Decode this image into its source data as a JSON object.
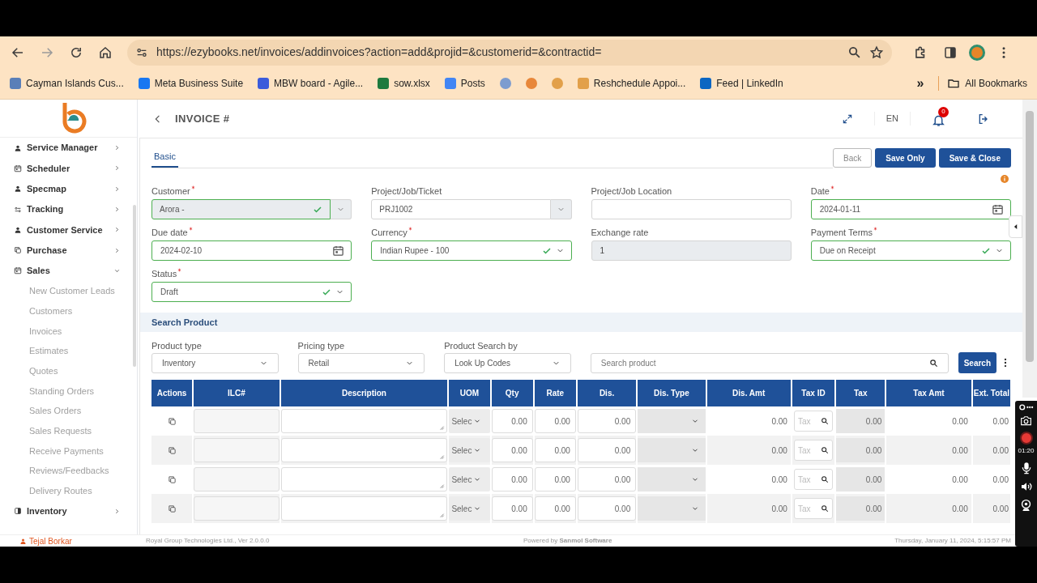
{
  "browser": {
    "url": "https://ezybooks.net/invoices/addinvoices?action=add&projid=&customerid=&contractid=",
    "bookmarks": [
      {
        "kind": "link",
        "label": "Cayman Islands Cus..."
      },
      {
        "kind": "link",
        "label": "Meta Business Suite"
      },
      {
        "kind": "link",
        "label": "MBW board - Agile..."
      },
      {
        "kind": "link",
        "label": "sow.xlsx"
      },
      {
        "kind": "link",
        "label": "Posts"
      },
      {
        "kind": "icon"
      },
      {
        "kind": "icon"
      },
      {
        "kind": "icon"
      },
      {
        "kind": "link",
        "label": "Reshchedule Appoi..."
      },
      {
        "kind": "link",
        "label": "Feed | LinkedIn"
      }
    ],
    "more": "»",
    "all_bookmarks": "All Bookmarks"
  },
  "sidebar": {
    "items": [
      {
        "label": "Service Manager",
        "expanded": false
      },
      {
        "label": "Scheduler",
        "expanded": false
      },
      {
        "label": "Specmap",
        "expanded": false
      },
      {
        "label": "Tracking",
        "expanded": false
      },
      {
        "label": "Customer Service",
        "expanded": false
      },
      {
        "label": "Purchase",
        "expanded": false
      },
      {
        "label": "Sales",
        "expanded": true,
        "children": [
          {
            "label": "New Customer Leads"
          },
          {
            "label": "Customers"
          },
          {
            "label": "Invoices"
          },
          {
            "label": "Estimates"
          },
          {
            "label": "Quotes"
          },
          {
            "label": "Standing Orders"
          },
          {
            "label": "Sales Orders"
          },
          {
            "label": "Sales Requests"
          },
          {
            "label": "Receive Payments"
          },
          {
            "label": "Reviews/Feedbacks"
          },
          {
            "label": "Delivery Routes"
          }
        ]
      },
      {
        "label": "Inventory",
        "expanded": false
      }
    ],
    "user": "Tejal Borkar"
  },
  "header": {
    "title": "INVOICE #",
    "language": "EN",
    "notifications": "0"
  },
  "tabs": [
    {
      "label": "Basic",
      "selected": true
    }
  ],
  "buttons": [
    {
      "label": "Back",
      "kind": "secondary"
    },
    {
      "label": "Save Only",
      "kind": "primary"
    },
    {
      "label": "Save & Close",
      "kind": "primary"
    }
  ],
  "fields": [
    {
      "label": "Customer",
      "required": true,
      "kind": "combo",
      "value": "Arora -",
      "valid": true,
      "disabled": true
    },
    {
      "label": "Project/Job/Ticket",
      "required": false,
      "kind": "combo",
      "value": "PRJ1002",
      "valid": false,
      "disabled": false
    },
    {
      "label": "Project/Job Location",
      "required": false,
      "kind": "text",
      "valid": false
    },
    {
      "label": "Date",
      "required": true,
      "kind": "date",
      "value": "2024-01-11",
      "valid": true
    },
    {
      "label": "Due date",
      "required": true,
      "kind": "date",
      "value": "2024-02-10",
      "valid": true
    },
    {
      "label": "Currency",
      "required": true,
      "kind": "select",
      "value": "Indian Rupee - 100",
      "valid": true
    },
    {
      "label": "Exchange rate",
      "required": false,
      "kind": "readonly",
      "value": "1",
      "valid": false
    },
    {
      "label": "Payment Terms",
      "required": true,
      "kind": "select",
      "value": "Due on Receipt",
      "valid": true
    },
    {
      "label": "Status",
      "required": true,
      "kind": "select",
      "value": "Draft",
      "valid": true
    }
  ],
  "search_product": {
    "title": "Search Product",
    "filters": [
      {
        "label": "Product type",
        "value": "Inventory"
      },
      {
        "label": "Pricing type",
        "value": "Retail"
      },
      {
        "label": "Product Search by",
        "value": "Look Up Codes"
      }
    ],
    "placeholder": "Search product",
    "button": "Search"
  },
  "table": {
    "columns": [
      "Actions",
      "ILC#",
      "Description",
      "UOM",
      "Qty",
      "Rate",
      "Dis.",
      "Dis. Type",
      "Dis. Amt",
      "Tax ID",
      "Tax",
      "Tax Amt",
      "Ext. Total"
    ],
    "rows": [
      {
        "uom": "Selec",
        "qty": "0.00",
        "rate": "0.00",
        "dis": "0.00",
        "dis_amt": "0.00",
        "tax_id_placeholder": "Tax",
        "tax": "0.00",
        "tax_amt": "0.00",
        "ext_total": "0.00"
      },
      {
        "uom": "Selec",
        "qty": "0.00",
        "rate": "0.00",
        "dis": "0.00",
        "dis_amt": "0.00",
        "tax_id_placeholder": "Tax",
        "tax": "0.00",
        "tax_amt": "0.00",
        "ext_total": "0.00"
      },
      {
        "uom": "Selec",
        "qty": "0.00",
        "rate": "0.00",
        "dis": "0.00",
        "dis_amt": "0.00",
        "tax_id_placeholder": "Tax",
        "tax": "0.00",
        "tax_amt": "0.00",
        "ext_total": "0.00"
      },
      {
        "uom": "Selec",
        "qty": "0.00",
        "rate": "0.00",
        "dis": "0.00",
        "dis_amt": "0.00",
        "tax_id_placeholder": "Tax",
        "tax": "0.00",
        "tax_amt": "0.00",
        "ext_total": "0.00"
      }
    ]
  },
  "footer": {
    "company": "Royal Group Technologies Ltd., Ver 2.0.0.0",
    "powered": "Powered by **Sanmol Software**",
    "datetime": "Thursday, January 11, 2024, 5:15:57 PM"
  },
  "recorder": {
    "time": "01:20"
  }
}
